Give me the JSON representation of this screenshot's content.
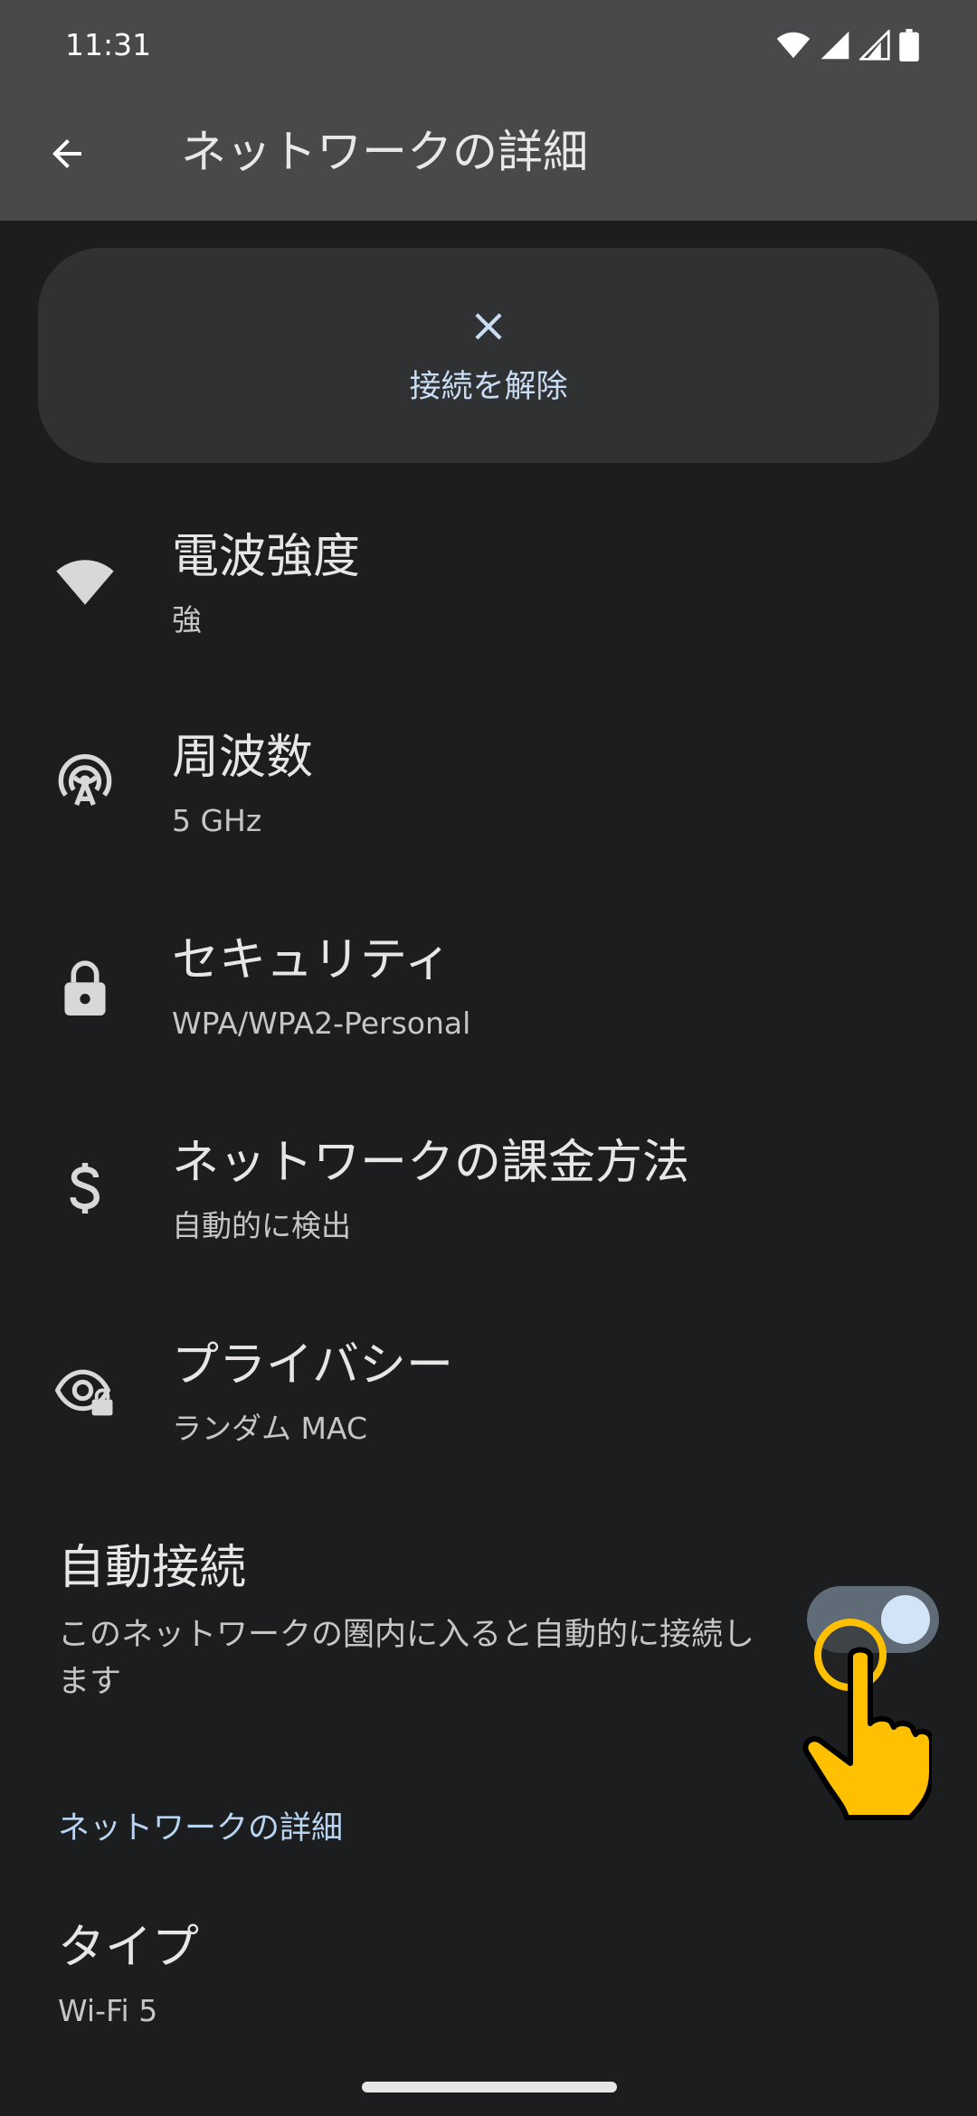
{
  "status_bar": {
    "time": "11:31",
    "icons": [
      "wifi-icon",
      "signal-icon",
      "signal-no-data-icon",
      "battery-icon"
    ]
  },
  "header": {
    "title": "ネットワークの詳細",
    "back_icon": "arrow-back-icon"
  },
  "disconnect": {
    "icon": "close-icon",
    "label": "接続を解除"
  },
  "rows": [
    {
      "icon": "wifi-icon",
      "title": "電波強度",
      "value": "強"
    },
    {
      "icon": "antenna-icon",
      "title": "周波数",
      "value": "5 GHz"
    },
    {
      "icon": "lock-icon",
      "title": "セキュリティ",
      "value": "WPA/WPA2-Personal"
    },
    {
      "icon": "dollar-icon",
      "title": "ネットワークの課金方法",
      "value": "自動的に検出"
    },
    {
      "icon": "eye-lock-icon",
      "title": "プライバシー",
      "value": "ランダム MAC"
    }
  ],
  "auto_connect": {
    "title": "自動接続",
    "description": "このネットワークの圏内に入ると自動的に接続します",
    "enabled": true
  },
  "details_section": {
    "header": "ネットワークの詳細",
    "type_title": "タイプ",
    "type_value": "Wi-Fi 5"
  },
  "colors": {
    "app_bar": "#48494b",
    "background": "#1c1d1f",
    "card": "#303133",
    "accent_text": "#c9def5",
    "toggle_track": "#5f6b76",
    "toggle_thumb": "#d2e4f8",
    "tap_indicator": "#ffc000"
  }
}
